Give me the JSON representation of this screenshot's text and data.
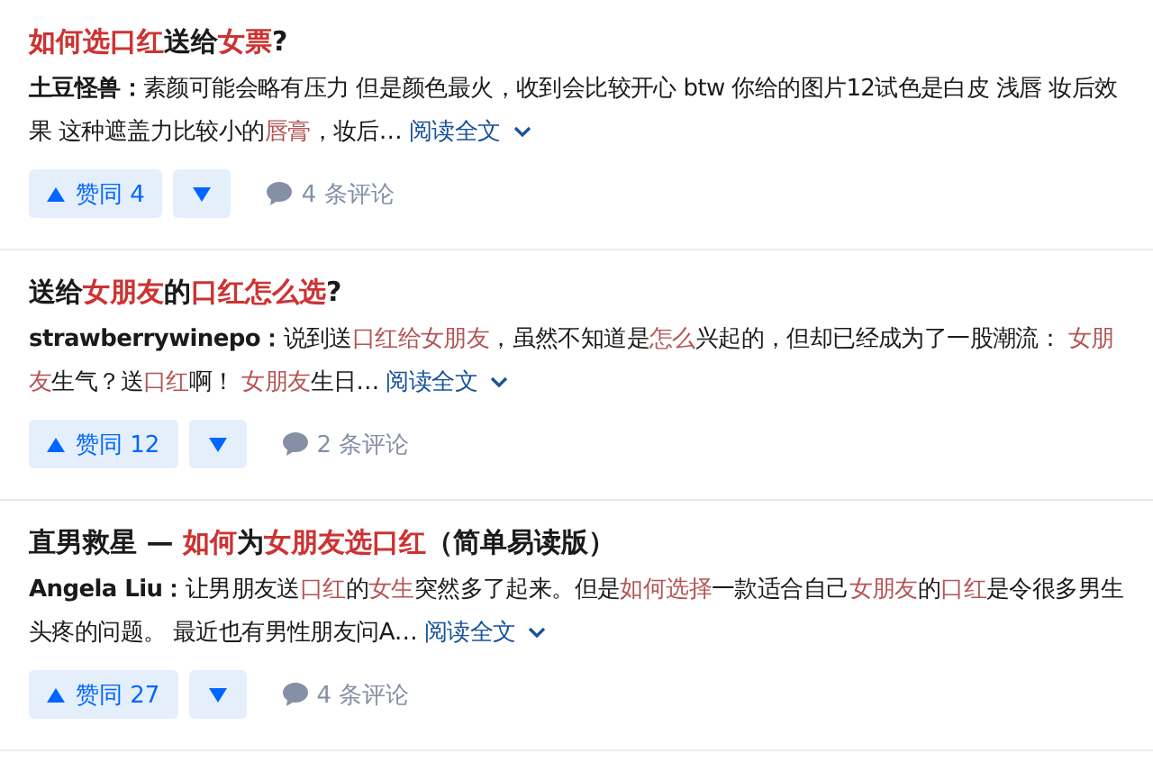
{
  "results": [
    {
      "title": [
        {
          "text": "如何选口红",
          "highlight": true
        },
        {
          "text": "送给",
          "highlight": false
        },
        {
          "text": "女票",
          "highlight": true
        },
        {
          "text": "?",
          "highlight": false
        }
      ],
      "author": "土豆怪兽：",
      "excerpt": [
        {
          "text": "素颜可能会略有压力 但是颜色最火，收到会比较开心 btw 你给的图片12试色是白皮 浅唇 妆后效果 这种遮盖力比较小的",
          "highlight": false
        },
        {
          "text": "唇膏",
          "highlight": true
        },
        {
          "text": "，妆后…",
          "highlight": false
        }
      ],
      "read_more": "阅读全文",
      "upvote": "赞同 4",
      "comments": "4 条评论"
    },
    {
      "title": [
        {
          "text": "送给",
          "highlight": false
        },
        {
          "text": "女朋友",
          "highlight": true
        },
        {
          "text": "的",
          "highlight": false
        },
        {
          "text": "口红怎么选",
          "highlight": true
        },
        {
          "text": "?",
          "highlight": false
        }
      ],
      "author": "strawberrywinepo：",
      "excerpt": [
        {
          "text": "说到送",
          "highlight": false
        },
        {
          "text": "口红给女朋友",
          "highlight": true
        },
        {
          "text": "，虽然不知道是",
          "highlight": false
        },
        {
          "text": "怎么",
          "highlight": true
        },
        {
          "text": "兴起的，但却已经成为了一股潮流： ",
          "highlight": false
        },
        {
          "text": "女朋友",
          "highlight": true
        },
        {
          "text": "生气？送",
          "highlight": false
        },
        {
          "text": "口红",
          "highlight": true
        },
        {
          "text": "啊！ ",
          "highlight": false
        },
        {
          "text": "女朋友",
          "highlight": true
        },
        {
          "text": "生日…",
          "highlight": false
        }
      ],
      "read_more": "阅读全文",
      "upvote": "赞同 12",
      "comments": "2 条评论"
    },
    {
      "title": [
        {
          "text": "直男救星 — ",
          "highlight": false
        },
        {
          "text": "如何",
          "highlight": true
        },
        {
          "text": "为",
          "highlight": false
        },
        {
          "text": "女朋友选口红",
          "highlight": true
        },
        {
          "text": "（简单易读版）",
          "highlight": false
        }
      ],
      "author": "Angela Liu：",
      "excerpt": [
        {
          "text": "让男朋友送",
          "highlight": false
        },
        {
          "text": "口红",
          "highlight": true
        },
        {
          "text": "的",
          "highlight": false
        },
        {
          "text": "女生",
          "highlight": true
        },
        {
          "text": "突然多了起来。但是",
          "highlight": false
        },
        {
          "text": "如何选择",
          "highlight": true
        },
        {
          "text": "一款适合自己",
          "highlight": false
        },
        {
          "text": "女朋友",
          "highlight": true
        },
        {
          "text": "的",
          "highlight": false
        },
        {
          "text": "口红",
          "highlight": true
        },
        {
          "text": "是令很多男生头疼的问题。 最近也有男性朋友问A…",
          "highlight": false
        }
      ],
      "read_more": "阅读全文",
      "upvote": "赞同 27",
      "comments": "4 条评论"
    }
  ]
}
